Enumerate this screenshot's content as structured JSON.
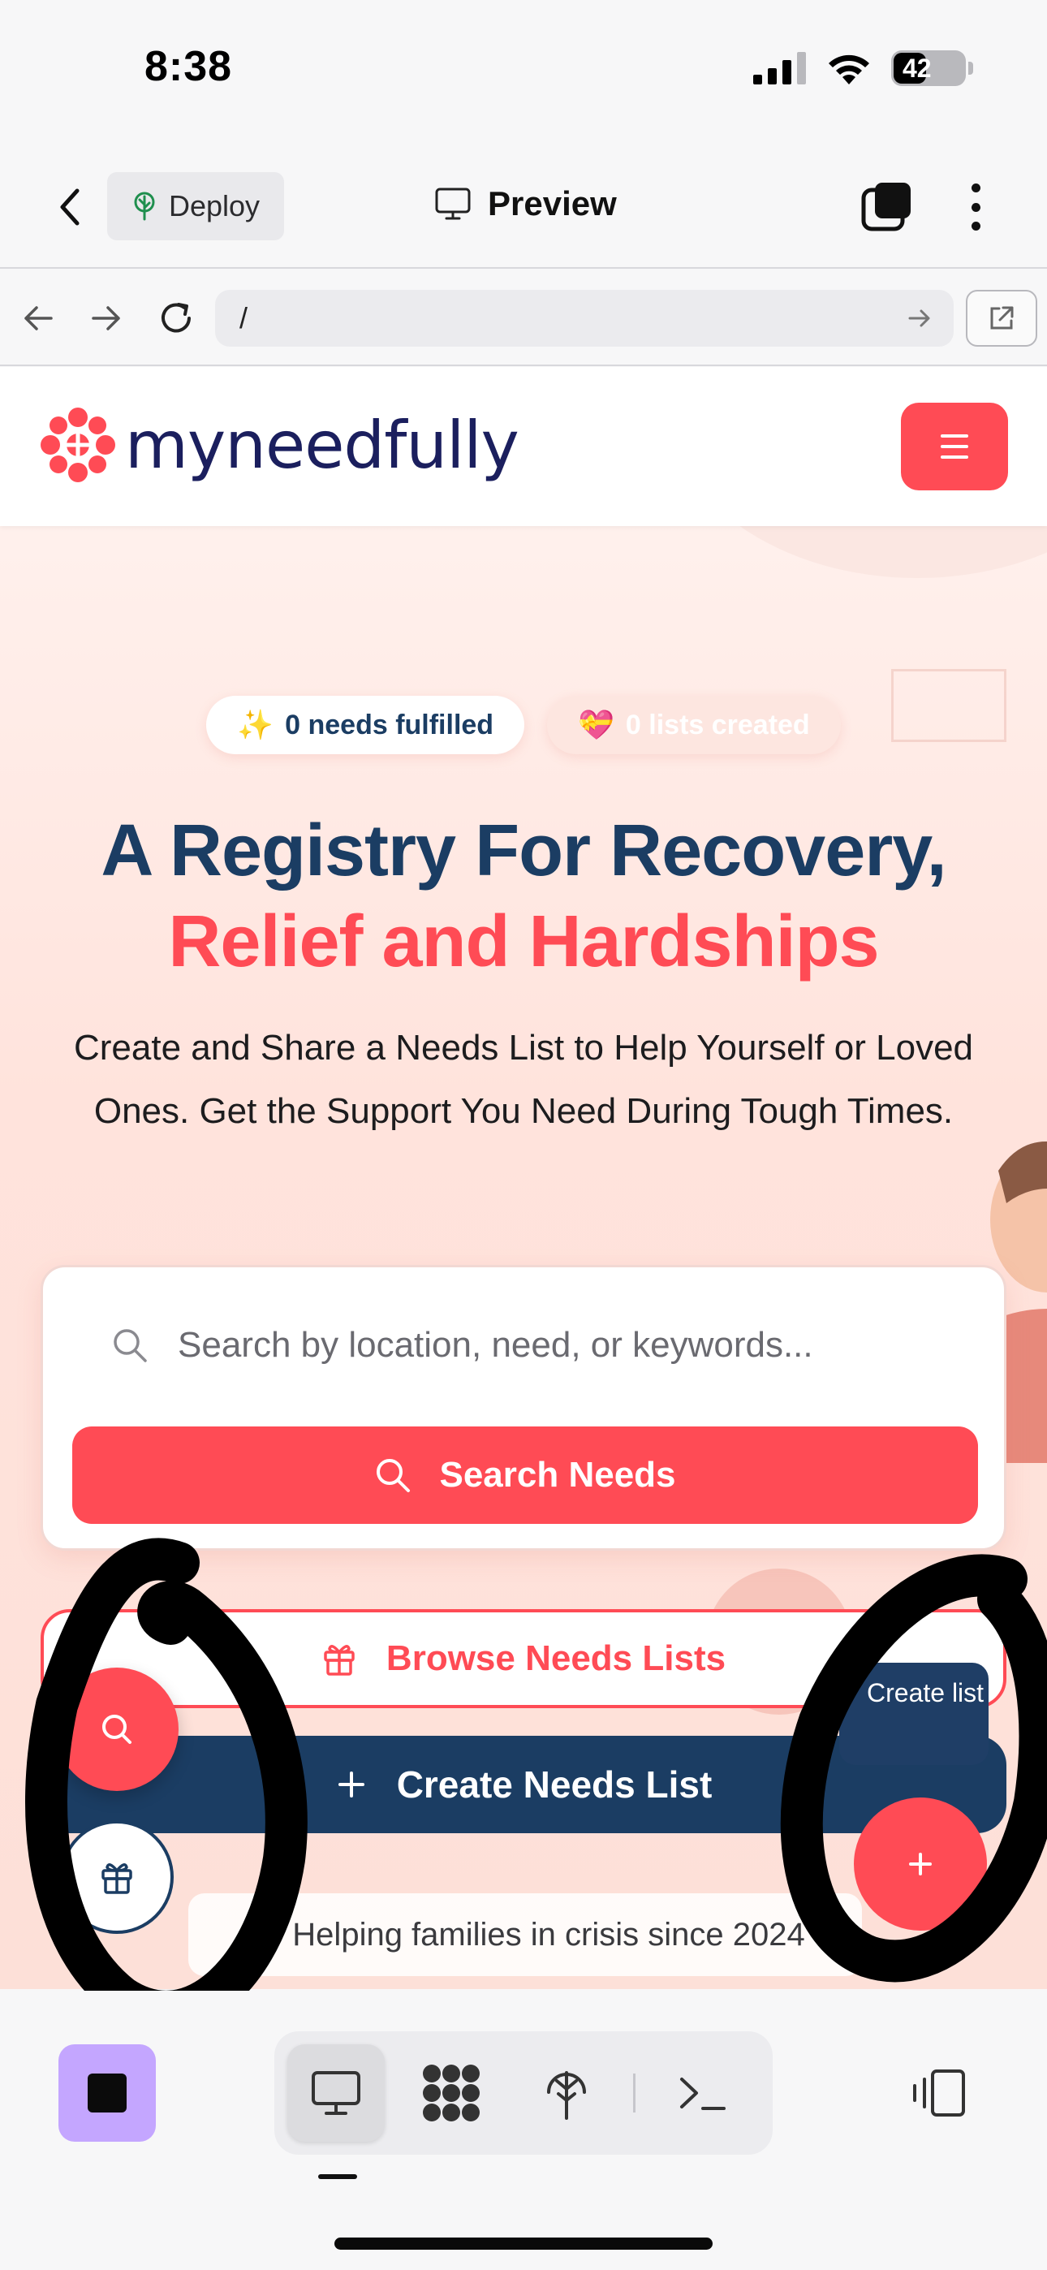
{
  "status_bar": {
    "time": "8:38",
    "battery": "42"
  },
  "app_bar": {
    "deploy_label": "Deploy",
    "preview_label": "Preview"
  },
  "url_bar": {
    "url": "/"
  },
  "site": {
    "brand": "myneedfully",
    "stats": [
      {
        "emoji": "✨",
        "label": "0 needs fulfilled"
      },
      {
        "emoji": "💝",
        "label": "0 lists created"
      }
    ],
    "hero": {
      "line1": "A Registry For Recovery,",
      "line2": "Relief and Hardships",
      "subtitle": "Create and Share a Needs List to Help Yourself or Loved Ones. Get the Support You Need During Tough Times."
    },
    "search": {
      "placeholder": "Search by location, need, or keywords...",
      "button_label": "Search Needs"
    },
    "browse_label": "Browse Needs Lists",
    "create_label": "Create Needs List",
    "create_tooltip": "Create list",
    "tagline": "Helping families in crisis since 2024"
  },
  "colors": {
    "brand_red": "#ff4b55",
    "brand_navy": "#1b3d63",
    "stop_purple": "#c4a6ff"
  },
  "icons": [
    "back-icon",
    "sprout-icon",
    "monitor-icon",
    "tabs-icon",
    "more-icon",
    "arrow-left-icon",
    "arrow-right-icon",
    "reload-icon",
    "external-link-icon",
    "logo-mark-icon",
    "menu-icon",
    "search-icon",
    "gift-icon",
    "plus-icon",
    "heart-icon",
    "stop-icon",
    "grid-icon",
    "deploy-icon",
    "terminal-icon",
    "panel-icon"
  ]
}
